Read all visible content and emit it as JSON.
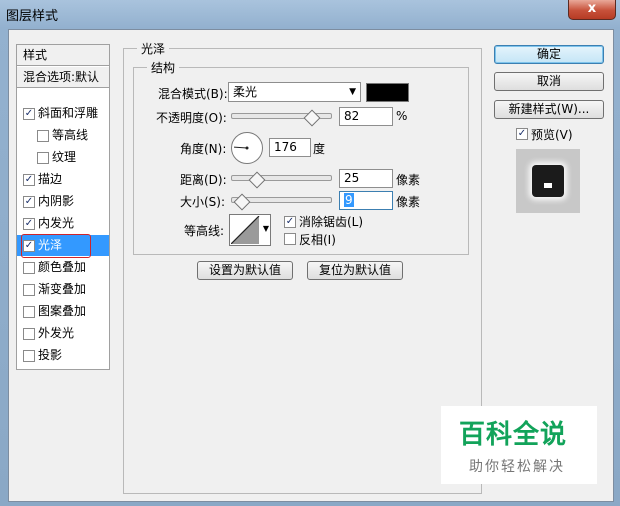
{
  "window": {
    "title": "图层样式",
    "close_label": "x"
  },
  "sidebar": {
    "header": "样式",
    "blend_options": "混合选项:默认",
    "items": [
      {
        "label": "斜面和浮雕",
        "checked": true,
        "indent": false
      },
      {
        "label": "等高线",
        "checked": false,
        "indent": true
      },
      {
        "label": "纹理",
        "checked": false,
        "indent": true
      },
      {
        "label": "描边",
        "checked": true,
        "indent": false
      },
      {
        "label": "内阴影",
        "checked": true,
        "indent": false
      },
      {
        "label": "内发光",
        "checked": true,
        "indent": false
      },
      {
        "label": "光泽",
        "checked": true,
        "indent": false,
        "selected": true
      },
      {
        "label": "颜色叠加",
        "checked": false,
        "indent": false
      },
      {
        "label": "渐变叠加",
        "checked": false,
        "indent": false
      },
      {
        "label": "图案叠加",
        "checked": false,
        "indent": false
      },
      {
        "label": "外发光",
        "checked": false,
        "indent": false
      },
      {
        "label": "投影",
        "checked": false,
        "indent": false
      }
    ]
  },
  "panel": {
    "title": "光泽",
    "structure_title": "结构",
    "blend_mode_label": "混合模式(B):",
    "blend_mode_value": "柔光",
    "blend_color": "#000000",
    "opacity_label": "不透明度(O):",
    "opacity_value": "82",
    "opacity_unit": "%",
    "angle_label": "角度(N):",
    "angle_value": "176",
    "angle_unit": "度",
    "distance_label": "距离(D):",
    "distance_value": "25",
    "distance_unit": "像素",
    "size_label": "大小(S):",
    "size_value": "9",
    "size_unit": "像素",
    "contour_label": "等高线:",
    "antialias_label": "消除锯齿(L)",
    "antialias_checked": true,
    "invert_label": "反相(I)",
    "invert_checked": false,
    "set_default_label": "设置为默认值",
    "reset_default_label": "复位为默认值"
  },
  "buttons": {
    "ok": "确定",
    "cancel": "取消",
    "new_style": "新建样式(W)...",
    "preview_label": "预览(V)",
    "preview_checked": true
  },
  "watermark": {
    "main": "百科全说",
    "sub": "助你轻松解决"
  },
  "check_glyph": "✓"
}
